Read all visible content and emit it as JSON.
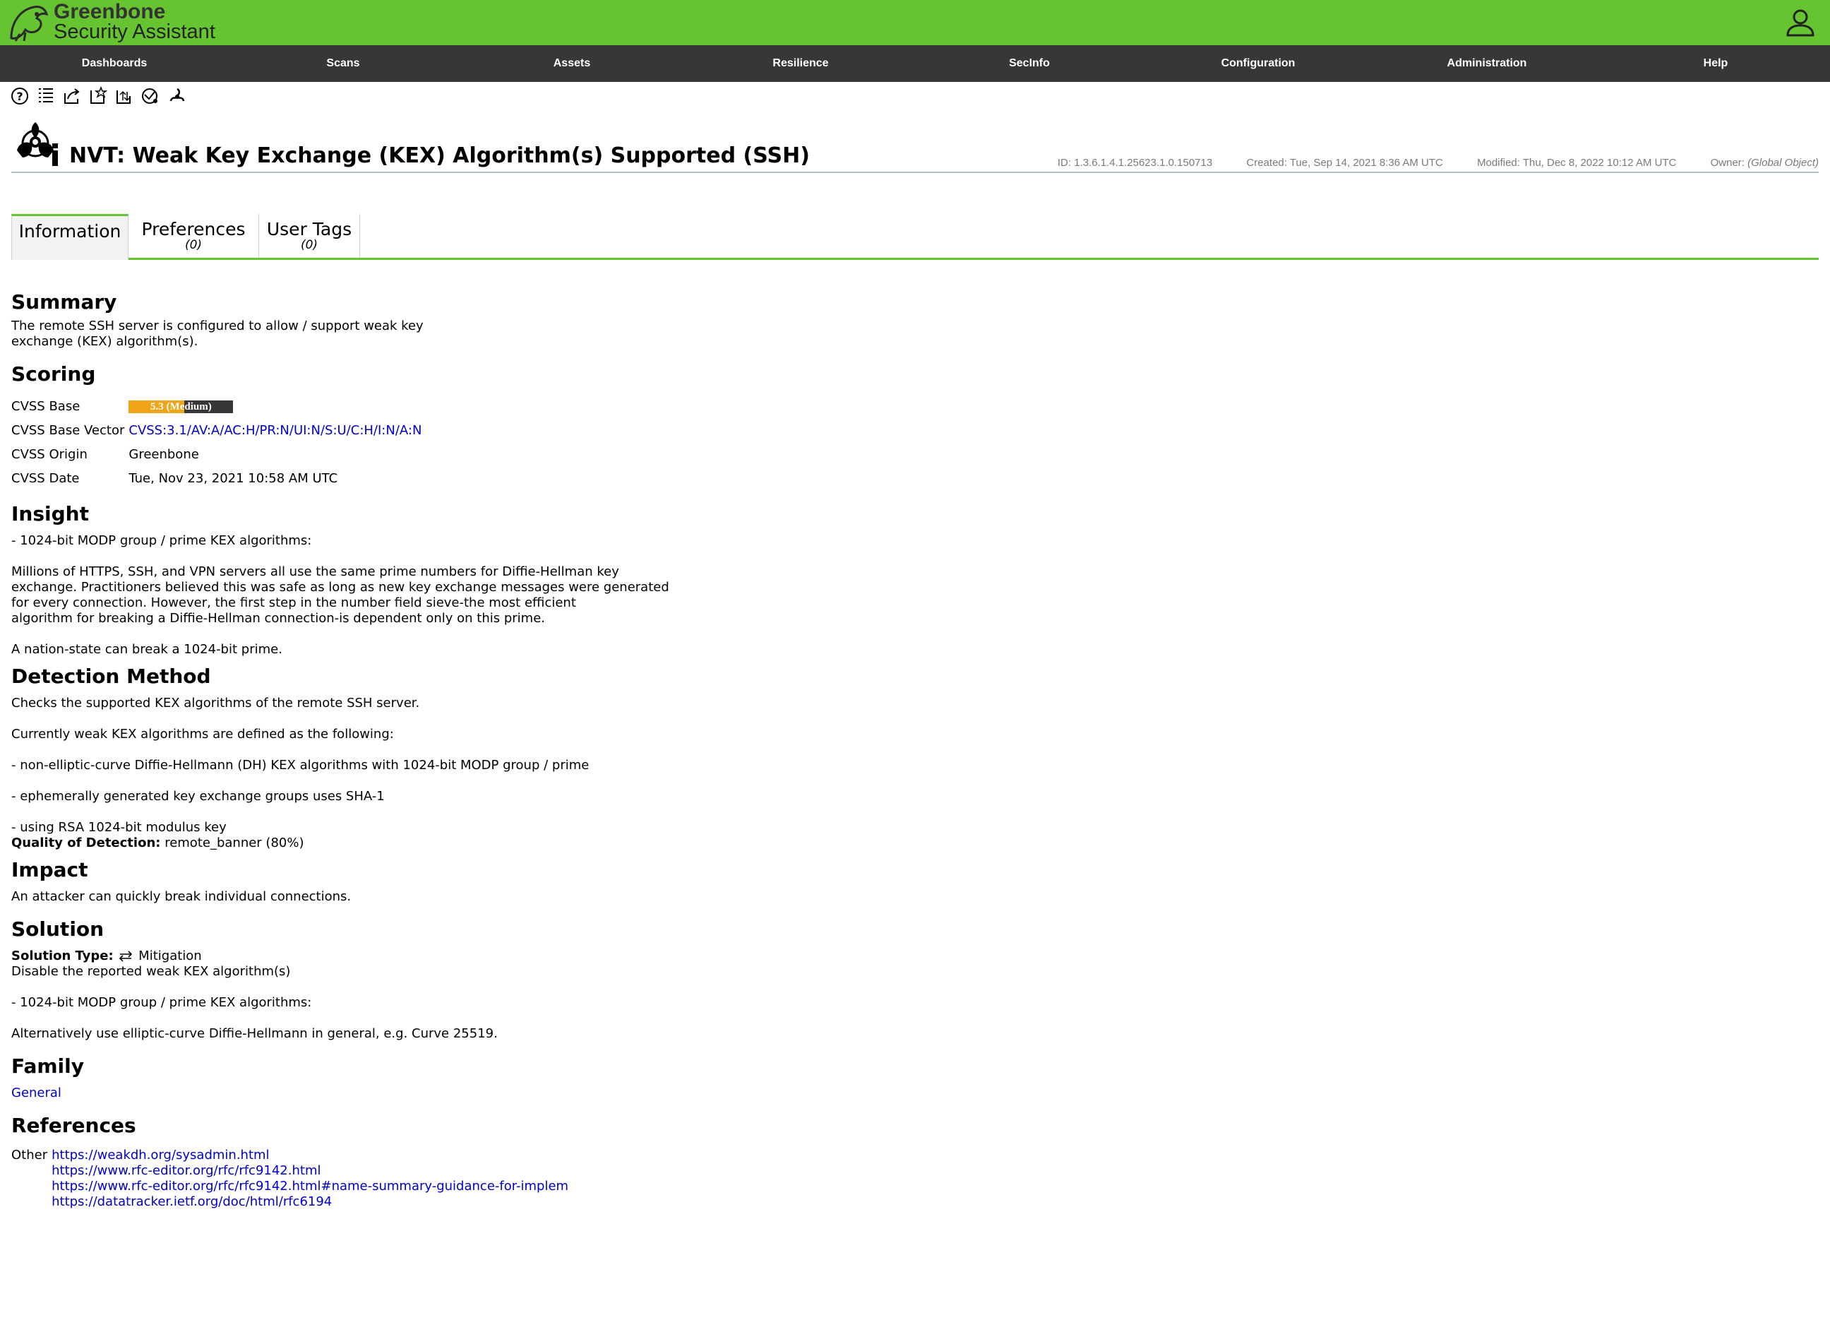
{
  "header": {
    "brand_line1": "Greenbone",
    "brand_line2": "Security Assistant",
    "colors": {
      "bar": "#66c430",
      "menu": "#393637"
    }
  },
  "menu": [
    "Dashboards",
    "Scans",
    "Assets",
    "Resilience",
    "SecInfo",
    "Configuration",
    "Administration",
    "Help"
  ],
  "toolbar": {
    "icons": [
      "help-icon",
      "list-icon",
      "export-icon",
      "new-note-icon",
      "new-override-icon",
      "results-icon",
      "vulnerabilities-icon"
    ]
  },
  "page": {
    "title": "NVT: Weak Key Exchange (KEX) Algorithm(s) Supported (SSH)",
    "id": "ID: 1.3.6.1.4.1.25623.1.0.150713",
    "created": "Created: Tue, Sep 14, 2021 8:36 AM UTC",
    "modified": "Modified: Thu, Dec 8, 2022 10:12 AM UTC",
    "owner_label": "Owner: ",
    "owner_value": "(Global Object)"
  },
  "tabs": [
    {
      "label": "Information",
      "count": ""
    },
    {
      "label": "Preferences",
      "count": "(0)"
    },
    {
      "label": "User Tags",
      "count": "(0)"
    }
  ],
  "summary": {
    "heading": "Summary",
    "line1": "The remote SSH server is configured to allow / support weak key",
    "line2": "exchange (KEX) algorithm(s)."
  },
  "scoring": {
    "heading": "Scoring",
    "base_label": "CVSS Base",
    "base_value": "5.3 (Medium)",
    "base_score": 5.3,
    "severity_color": "#f0a519",
    "vector_label": "CVSS Base Vector",
    "vector_value": "CVSS:3.1/AV:A/AC:H/PR:N/UI:N/S:U/C:H/I:N/A:N",
    "origin_label": "CVSS Origin",
    "origin_value": "Greenbone",
    "date_label": "CVSS Date",
    "date_value": "Tue, Nov 23, 2021 10:58 AM UTC"
  },
  "insight": {
    "heading": "Insight",
    "p1": "- 1024-bit MODP group / prime KEX algorithms:",
    "p2_l1": "Millions of HTTPS, SSH, and VPN servers all use the same prime numbers for Diffie-Hellman key",
    "p2_l2": "exchange. Practitioners believed this was safe as long as new key exchange messages were generated",
    "p2_l3": "for every connection. However, the first step in the number field sieve-the most efficient",
    "p2_l4": "algorithm for breaking a Diffie-Hellman connection-is dependent only on this prime.",
    "p3": "A nation-state can break a 1024-bit prime."
  },
  "detection": {
    "heading": "Detection Method",
    "p1": "Checks the supported KEX algorithms of the remote SSH server.",
    "p2": "Currently weak KEX algorithms are defined as the following:",
    "p3": "- non-elliptic-curve Diffie-Hellmann (DH) KEX algorithms with 1024-bit MODP group / prime",
    "p4": "- ephemerally generated key exchange groups uses SHA-1",
    "p5": "- using RSA 1024-bit modulus key",
    "qod_label": "Quality of Detection:",
    "qod_value": " remote_banner (80%)"
  },
  "impact": {
    "heading": "Impact",
    "p1": "An attacker can quickly break individual connections."
  },
  "solution": {
    "heading": "Solution",
    "type_label": "Solution Type:",
    "type_value": "Mitigation",
    "p1": "Disable the reported weak KEX algorithm(s)",
    "p2": "- 1024-bit MODP group / prime KEX algorithms:",
    "p3": "Alternatively use elliptic-curve Diffie-Hellmann in general, e.g. Curve 25519."
  },
  "family": {
    "heading": "Family",
    "value": "General"
  },
  "references": {
    "heading": "References",
    "other_label": "Other",
    "links": [
      "https://weakdh.org/sysadmin.html",
      "https://www.rfc-editor.org/rfc/rfc9142.html",
      "https://www.rfc-editor.org/rfc/rfc9142.html#name-summary-guidance-for-implem",
      "https://datatracker.ietf.org/doc/html/rfc6194"
    ]
  }
}
